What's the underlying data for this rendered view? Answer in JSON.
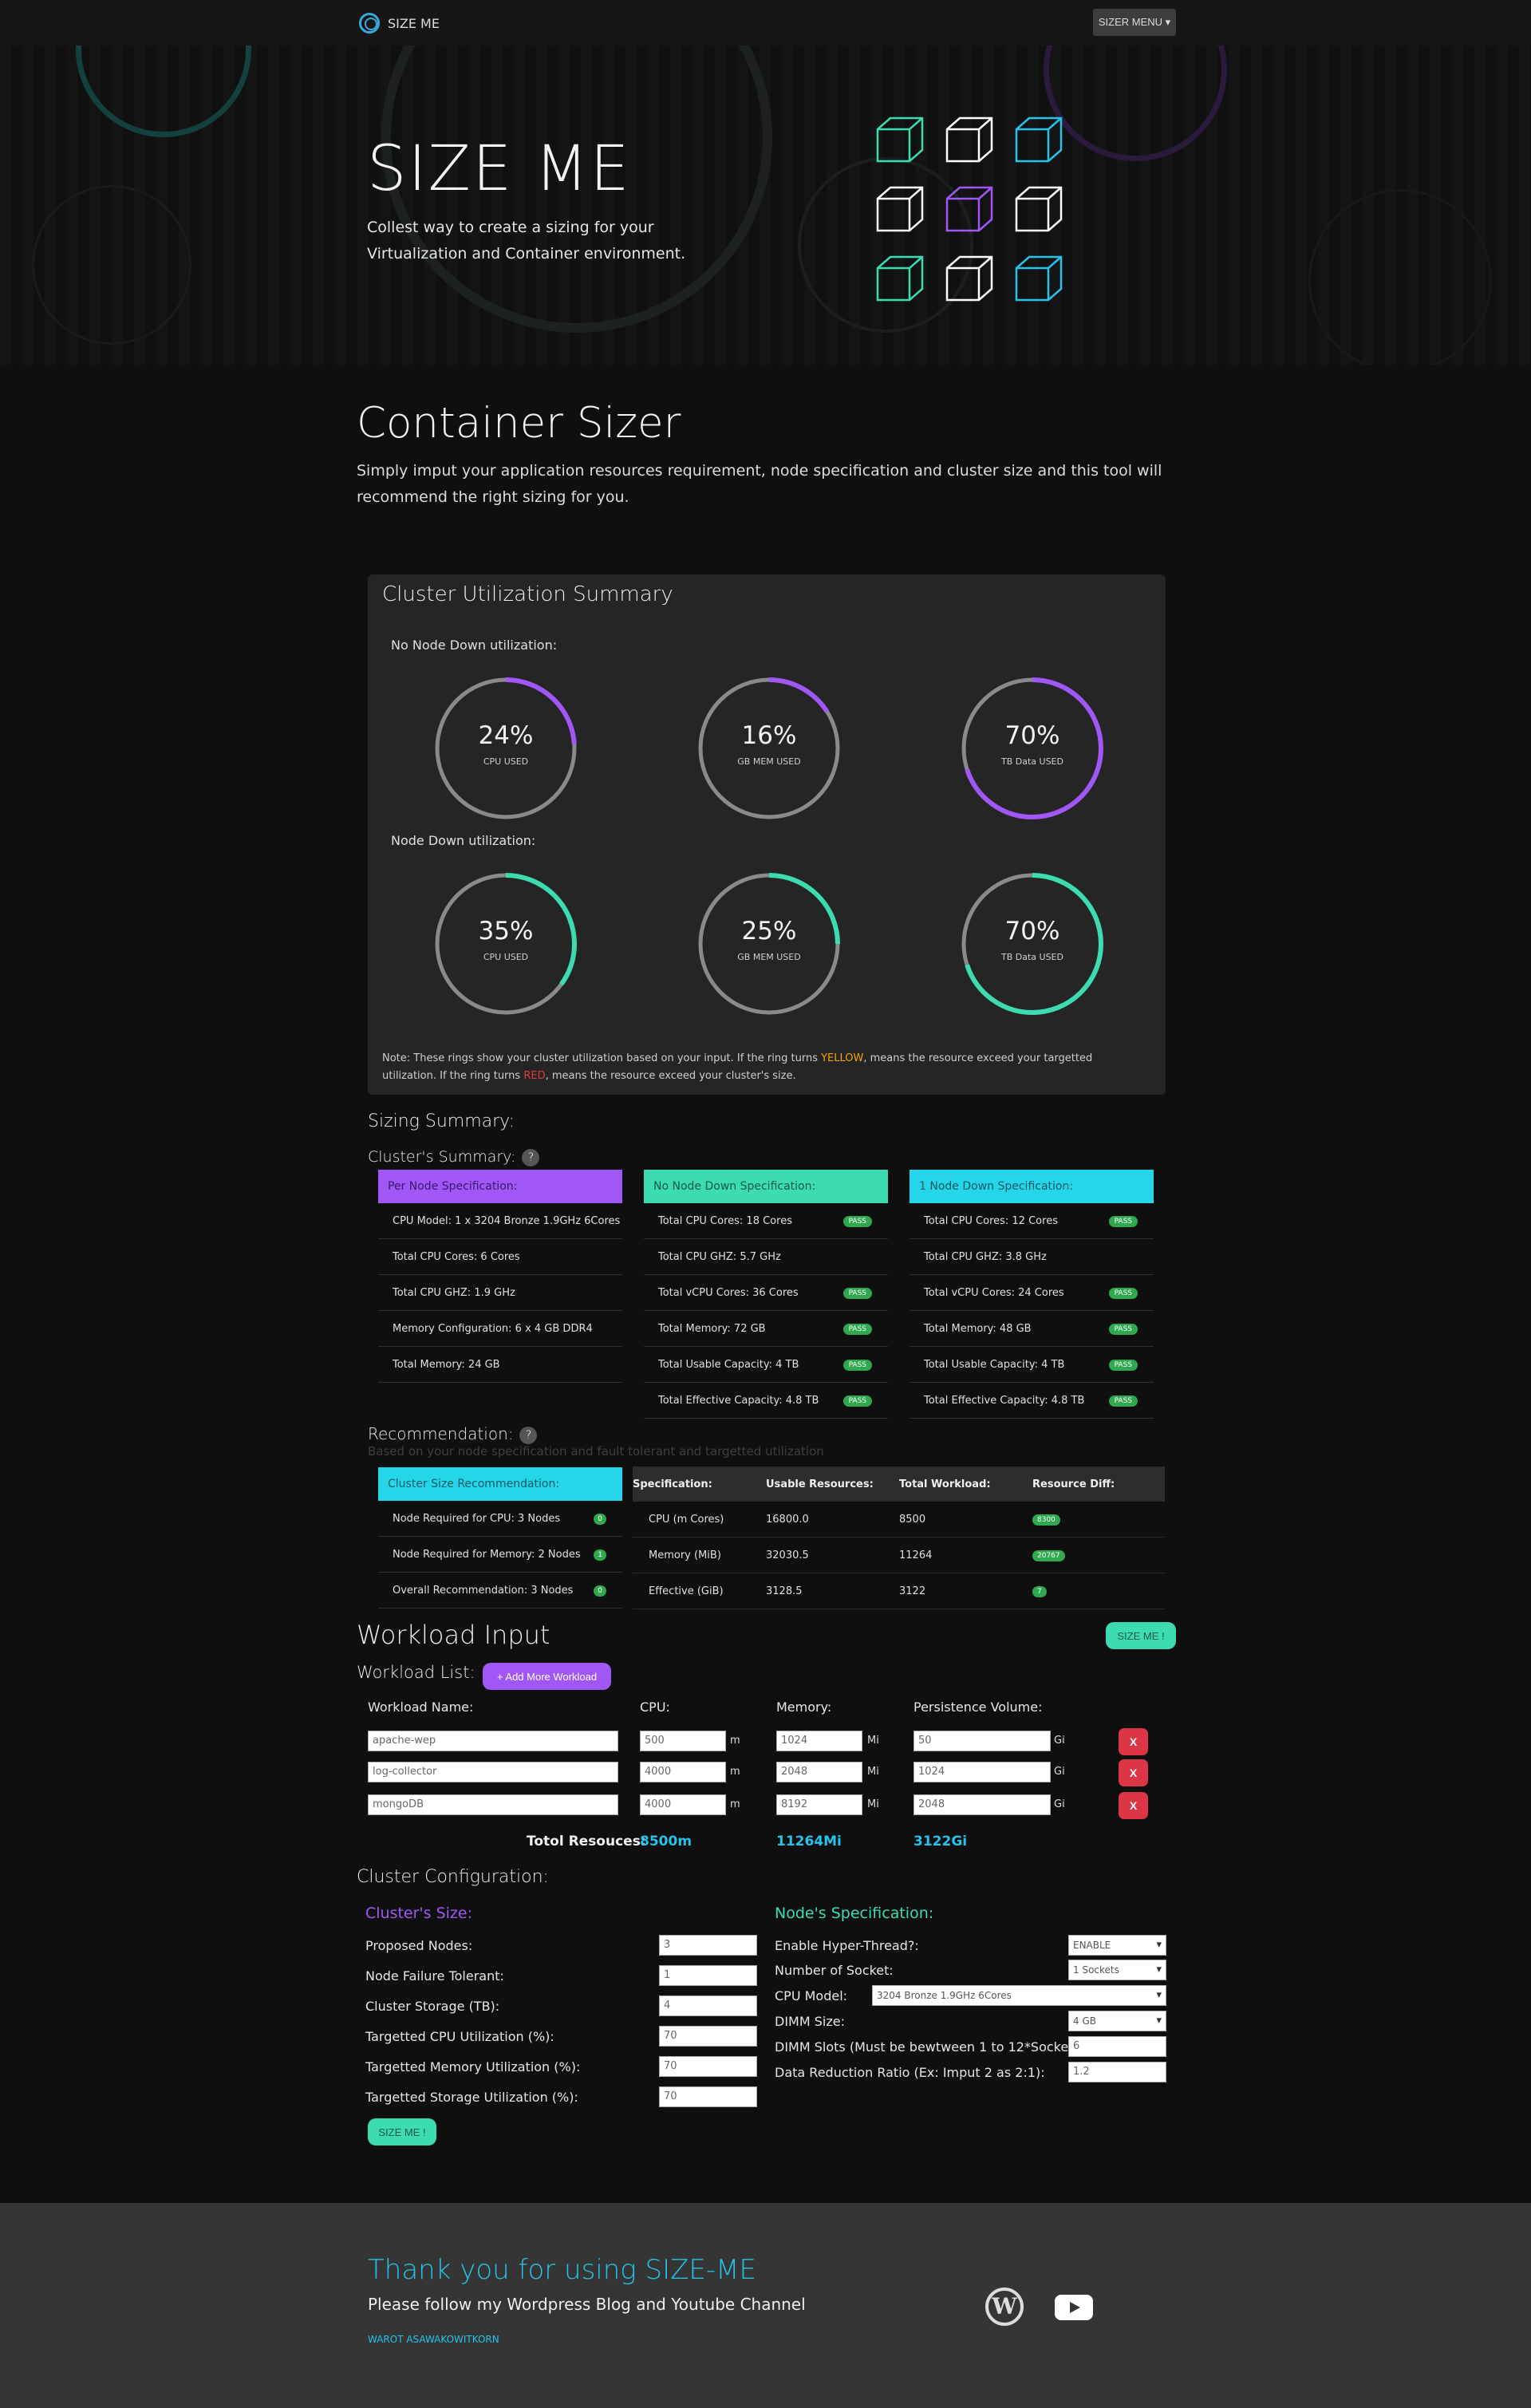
{
  "navbar": {
    "brand": "SIZE ME",
    "menu_label": "SIZER MENU"
  },
  "hero": {
    "title": "SIZE ME",
    "subtitle": "Collest way to create a sizing for your Virtualization and Container environment."
  },
  "page": {
    "title": "Container Sizer",
    "description": "Simply imput your application resources requirement, node specification and cluster size and this tool will recommend the right sizing for you."
  },
  "utilization": {
    "title": "Cluster Utilization Summary",
    "no_node_down_label": "No Node Down utilization:",
    "node_down_label": "Node Down utilization:",
    "no_node_down": [
      {
        "value": "24%",
        "caption": "CPU USED",
        "percent": 24
      },
      {
        "value": "16%",
        "caption": "GB MEM USED",
        "percent": 16
      },
      {
        "value": "70%",
        "caption": "TB Data USED",
        "percent": 70
      }
    ],
    "node_down": [
      {
        "value": "35%",
        "caption": "CPU USED",
        "percent": 35
      },
      {
        "value": "25%",
        "caption": "GB MEM USED",
        "percent": 25
      },
      {
        "value": "70%",
        "caption": "TB Data USED",
        "percent": 70
      }
    ],
    "note_part1": "Note: These rings show your cluster utilization based on your input. If the ring turns ",
    "note_yellow": "YELLOW",
    "note_part2": ", means the resource exceed your targetted utilization. If the ring turns ",
    "note_red": "RED",
    "note_part3": ", means the resource exceed your cluster's size.",
    "colors": {
      "no_node_down": "#a157f5",
      "node_down": "#3ddbb0",
      "track": "#8a8a8a"
    }
  },
  "sizing": {
    "title": "Sizing Summary:",
    "cluster_summary_label": "Cluster's Summary:",
    "help": "?",
    "pass_label": "PASS",
    "per_node": {
      "header": "Per Node Specification:",
      "rows": [
        "CPU Model: 1 x 3204 Bronze 1.9GHz 6Cores",
        "Total CPU Cores: 6 Cores",
        "Total CPU GHZ: 1.9 GHz",
        "Memory Configuration: 6 x 4 GB DDR4",
        "Total Memory: 24 GB"
      ]
    },
    "no_node_down": {
      "header": "No Node Down Specification:",
      "rows": [
        "Total CPU Cores: 18 Cores",
        "Total CPU GHZ: 5.7 GHz",
        "Total vCPU Cores: 36 Cores",
        "Total Memory: 72 GB",
        "Total Usable Capacity: 4 TB",
        "Total Effective Capacity: 4.8 TB"
      ],
      "pass": [
        true,
        false,
        true,
        true,
        true,
        true
      ]
    },
    "one_node_down": {
      "header": "1 Node Down Specification:",
      "rows": [
        "Total CPU Cores: 12 Cores",
        "Total CPU GHZ: 3.8 GHz",
        "Total vCPU Cores: 24 Cores",
        "Total Memory: 48 GB",
        "Total Usable Capacity: 4 TB",
        "Total Effective Capacity: 4.8 TB"
      ],
      "pass": [
        true,
        false,
        true,
        true,
        true,
        true
      ]
    }
  },
  "recommendation": {
    "title": "Recommendation:",
    "subtitle": "Based on your node specification and fault tolerant and targetted utilization",
    "header": "Cluster Size Recommendation:",
    "rows": [
      {
        "label": "Node Required for CPU: 3 Nodes",
        "badge": "0"
      },
      {
        "label": "Node Required for Memory: 2 Nodes",
        "badge": "1"
      },
      {
        "label": "Overall Recommendation: 3 Nodes",
        "badge": "0"
      }
    ],
    "columns": [
      "Specification:",
      "Usable Resources:",
      "Total Workload:",
      "Resource Diff:"
    ],
    "table": [
      [
        "CPU (m Cores)",
        "16800.0",
        "8500",
        "8300"
      ],
      [
        "Memory (MiB)",
        "32030.5",
        "11264",
        "20767"
      ],
      [
        "Effective (GiB)",
        "3128.5",
        "3122",
        "7"
      ]
    ]
  },
  "workload": {
    "title": "Workload Input",
    "size_me_label": "SIZE ME !",
    "list_label": "Workload List:",
    "add_label": "+ Add More Workload",
    "columns": {
      "name": "Workload Name:",
      "cpu": "CPU:",
      "memory": "Memory:",
      "pv": "Persistence Volume:"
    },
    "units": {
      "cpu": "m",
      "memory": "Mi",
      "pv": "Gi"
    },
    "remove_label": "X",
    "items": [
      {
        "name": "apache-wep",
        "cpu": "500",
        "memory": "1024",
        "pv": "50"
      },
      {
        "name": "log-collector",
        "cpu": "4000",
        "memory": "2048",
        "pv": "1024"
      },
      {
        "name": "mongoDB",
        "cpu": "4000",
        "memory": "8192",
        "pv": "2048"
      }
    ],
    "total_label": "Totol Resouces:",
    "total_cpu": "8500m",
    "total_memory": "11264Mi",
    "total_pv": "3122Gi"
  },
  "config": {
    "title": "Cluster Configuration:",
    "cluster_size_title": "Cluster's Size:",
    "cluster_fields": [
      {
        "label": "Proposed Nodes:",
        "value": "3"
      },
      {
        "label": "Node Failure Tolerant:",
        "value": "1"
      },
      {
        "label": "Cluster Storage (TB):",
        "value": "4"
      },
      {
        "label": "Targetted CPU Utilization (%):",
        "value": "70"
      },
      {
        "label": "Targetted Memory Utilization (%):",
        "value": "70"
      },
      {
        "label": "Targetted Storage Utilization (%):",
        "value": "70"
      }
    ],
    "size_me_label": "SIZE ME !",
    "node_spec_title": "Node's Specification:",
    "hyperthread_label": "Enable Hyper-Thread?:",
    "hyperthread_value": "ENABLE",
    "socket_label": "Number of Socket:",
    "socket_value": "1 Sockets",
    "cpu_model_label": "CPU Model:",
    "cpu_model_value": "3204 Bronze 1.9GHz 6Cores",
    "dimm_size_label": "DIMM Size:",
    "dimm_size_value": "4 GB",
    "dimm_slots_label": "DIMM Slots (Must be bewtween 1 to 12*Sockets):",
    "dimm_slots_value": "6",
    "drr_label": "Data Reduction Ratio (Ex: Imput 2 as 2:1):",
    "drr_value": "1.2"
  },
  "footer": {
    "title": "Thank you for using SIZE-ME",
    "text": "Please follow my Wordpress Blog and Youtube Channel",
    "author": "WAROT ASAWAKOWITKORN",
    "wordpress_icon": "wordpress-icon",
    "youtube_icon": "youtube-icon"
  }
}
